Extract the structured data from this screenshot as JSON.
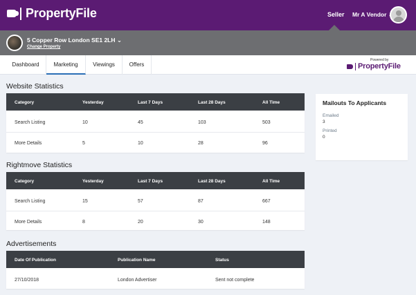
{
  "brand": {
    "name": "PropertyFile",
    "powered_by": "Powered by"
  },
  "header": {
    "seller_label": "Seller",
    "user_label": "Mr A Vendor ⌄"
  },
  "property": {
    "address": "5 Copper Row London SE1 2LH ⌄",
    "change_label": "Change Property"
  },
  "tabs": [
    {
      "label": "Dashboard",
      "active": false
    },
    {
      "label": "Marketing",
      "active": true
    },
    {
      "label": "Viewings",
      "active": false
    },
    {
      "label": "Offers",
      "active": false
    }
  ],
  "website_stats": {
    "title": "Website Statistics",
    "columns": [
      "Category",
      "Yesterday",
      "Last 7 Days",
      "Last 28 Days",
      "All Time"
    ],
    "rows": [
      [
        "Search Listing",
        "10",
        "45",
        "103",
        "503"
      ],
      [
        "More Details",
        "5",
        "10",
        "28",
        "96"
      ]
    ]
  },
  "rightmove_stats": {
    "title": "Rightmove Statistics",
    "columns": [
      "Category",
      "Yesterday",
      "Last 7 Days",
      "Last 28 Days",
      "All Time"
    ],
    "rows": [
      [
        "Search Listing",
        "15",
        "57",
        "87",
        "667"
      ],
      [
        "More Details",
        "8",
        "20",
        "30",
        "148"
      ]
    ]
  },
  "advertisements": {
    "title": "Advertisements",
    "columns": [
      "Date Of Publication",
      "Publication Name",
      "Status"
    ],
    "rows": [
      [
        "27/10/2018",
        "London Advertiser",
        "Sent not complete"
      ]
    ]
  },
  "mailouts": {
    "title": "Mailouts To Applicants",
    "emailed_label": "Emailed",
    "emailed_value": "3",
    "printed_label": "Printed",
    "printed_value": "0"
  },
  "colors": {
    "brand_purple": "#5b1b73",
    "property_bar": "#6d6e71",
    "table_header": "#3b3f44",
    "tab_active": "#2a6eb6"
  }
}
